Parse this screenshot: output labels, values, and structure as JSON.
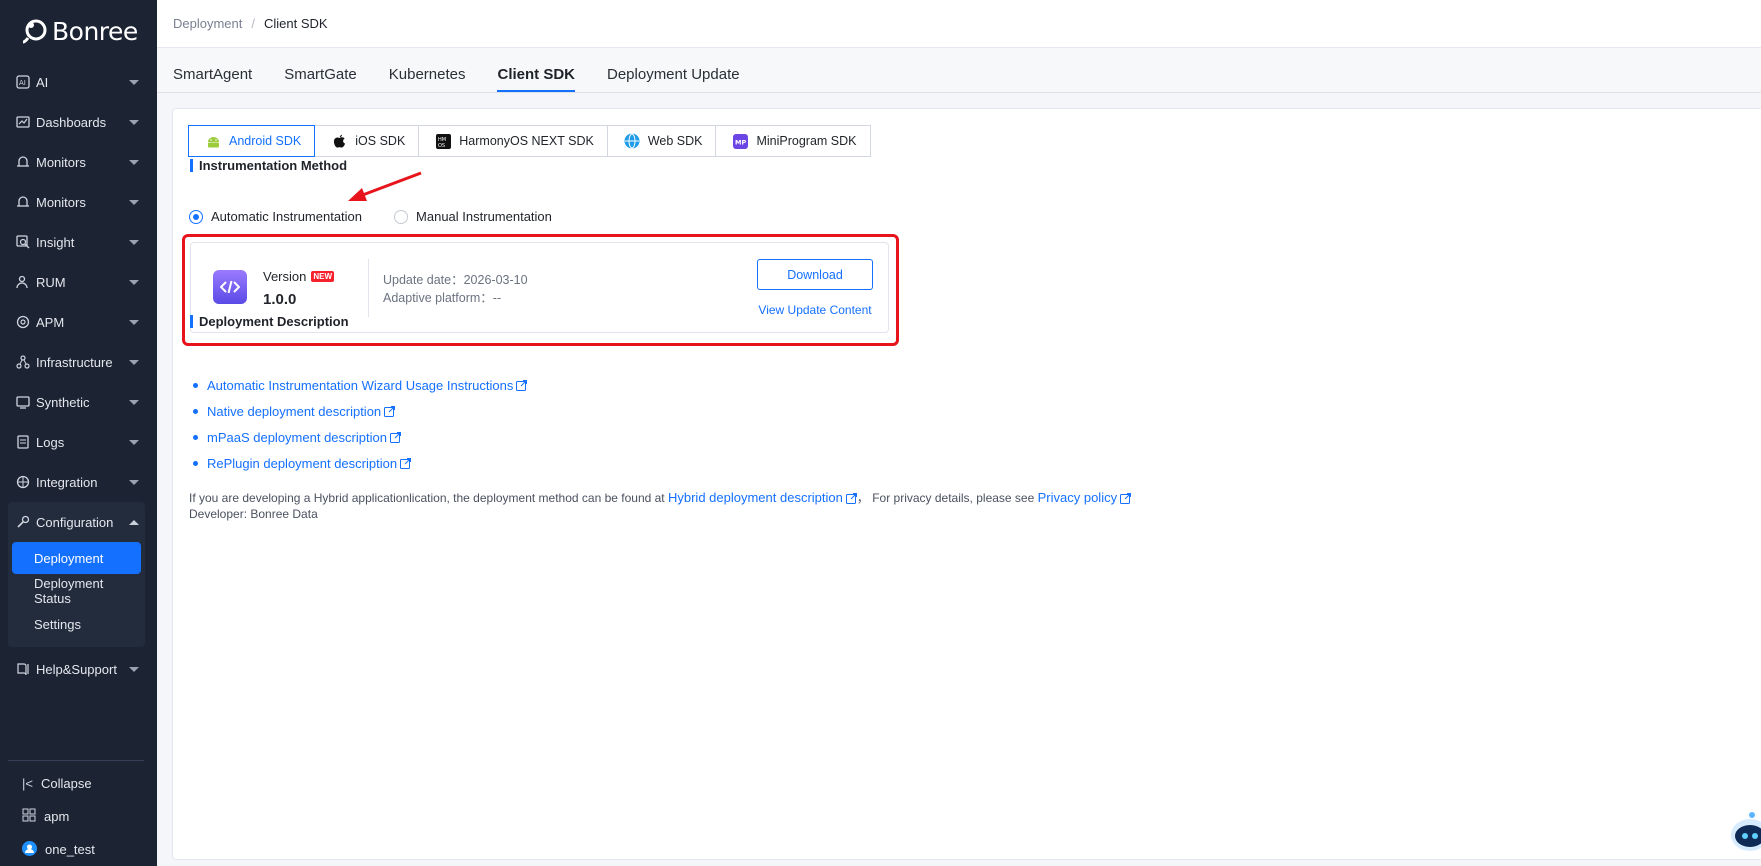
{
  "sidebar": {
    "logo_text": "Bonree",
    "items": [
      {
        "label": "AI",
        "icon": "ai-icon"
      },
      {
        "label": "Dashboards",
        "icon": "dashboard-icon"
      },
      {
        "label": "Monitors",
        "icon": "monitor-icon"
      },
      {
        "label": "Monitors",
        "icon": "monitor-icon"
      },
      {
        "label": "Insight",
        "icon": "insight-icon"
      },
      {
        "label": "RUM",
        "icon": "rum-icon"
      },
      {
        "label": "APM",
        "icon": "apm-icon"
      },
      {
        "label": "Infrastructure",
        "icon": "infrastructure-icon"
      },
      {
        "label": "Synthetic",
        "icon": "synthetic-icon"
      },
      {
        "label": "Logs",
        "icon": "logs-icon"
      },
      {
        "label": "Integration",
        "icon": "integration-icon"
      }
    ],
    "configuration": {
      "label": "Configuration",
      "sub_items": [
        "Deployment",
        "Deployment Status",
        "Settings"
      ],
      "active": "Deployment"
    },
    "help": "Help&Support",
    "footer": {
      "collapse": "Collapse",
      "workspace": "apm",
      "user": "one_test"
    }
  },
  "breadcrumb": {
    "parent": "Deployment",
    "separator": "/",
    "current": "Client SDK"
  },
  "tabs": [
    "SmartAgent",
    "SmartGate",
    "Kubernetes",
    "Client SDK",
    "Deployment Update"
  ],
  "active_tab": "Client SDK",
  "sdk_tabs": [
    "Android SDK",
    "iOS SDK",
    "HarmonyOS NEXT SDK",
    "Web SDK",
    "MiniProgram SDK"
  ],
  "active_sdk_tab": "Android SDK",
  "instrumentation": {
    "title": "Instrumentation Method",
    "options": [
      "Automatic Instrumentation",
      "Manual Instrumentation"
    ],
    "selected": "Automatic Instrumentation"
  },
  "version_card": {
    "label": "Version",
    "badge": "NEW",
    "version": "1.0.0",
    "update_date_label": "Update date：",
    "update_date": "2026-03-10",
    "platform_label": "Adaptive platform：",
    "platform": "--",
    "download": "Download",
    "view_update": "View Update Content"
  },
  "deployment_description": {
    "title": "Deployment Description",
    "links": [
      "Automatic Instrumentation Wizard Usage Instructions",
      "Native deployment description",
      "mPaaS deployment description",
      "RePlugin deployment description"
    ],
    "hybrid_prefix": "If you are developing a Hybrid applicationlication, the deployment method can be found at ",
    "hybrid_link": "Hybrid deployment description",
    "privacy_prefix": "，  For privacy details, please see ",
    "privacy_link": "Privacy policy",
    "developer": "Developer: Bonree Data"
  },
  "colors": {
    "accent": "#1470ff",
    "highlight": "#e8141c",
    "sidebar_bg": "#1c2433"
  }
}
